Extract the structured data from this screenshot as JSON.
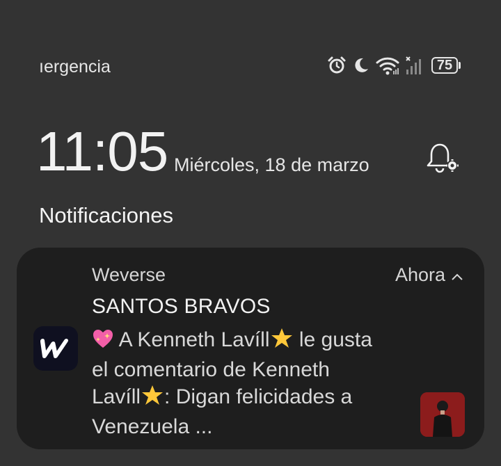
{
  "status_bar": {
    "carrier_text": "ıergencia",
    "battery_level": "75",
    "icons": [
      "alarm-icon",
      "moon-icon",
      "wifi-icon",
      "signal-icon",
      "battery-icon"
    ]
  },
  "lock": {
    "time": "11:05",
    "date": "Miércoles, 18 de marzo"
  },
  "section_title": "Notificaciones",
  "notification": {
    "app_name": "Weverse",
    "time_label": "Ahora",
    "title": "SANTOS BRAVOS",
    "body_parts": {
      "p1": " A Kenneth Lavíll",
      "p2": " le gusta el comentario de Kenneth Lavíll",
      "p3": ": Digan felicidades a Venezuela ..."
    },
    "emojis": [
      "sparkling-heart-icon",
      "glowing-star-icon",
      "glowing-star-icon"
    ]
  },
  "colors": {
    "background": "#333333",
    "card": "#1e1e1e",
    "app_icon_bg": "#0f1020",
    "thumb_bg": "#8c1c1c"
  }
}
